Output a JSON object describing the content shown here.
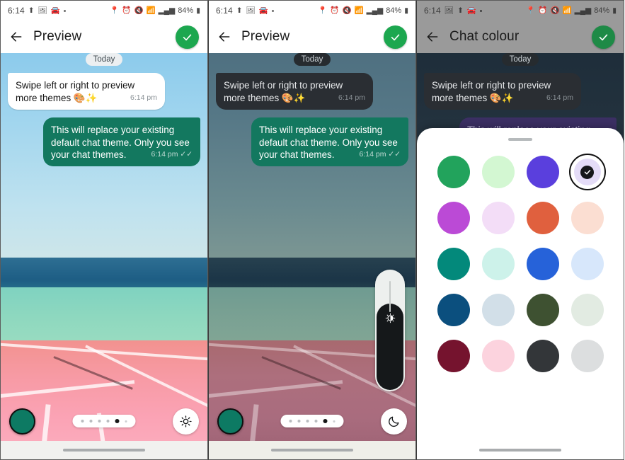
{
  "status_bar": {
    "time": "6:14",
    "battery": "84%",
    "left_icons": [
      "upload-icon",
      "gallery-icon",
      "car-icon",
      "dot-icon"
    ],
    "right_icons": [
      "location-icon",
      "alarm-icon",
      "mute-icon",
      "wifi-icon",
      "signal-icon"
    ]
  },
  "panels": [
    {
      "id": "preview-light",
      "title": "Preview",
      "back_icon": "back-arrow-icon",
      "confirm_icon": "check-icon",
      "theme": "light",
      "mode_button_icon": "sun-icon",
      "swatch_color": "#0d7a63",
      "chat": {
        "day_label": "Today",
        "incoming": {
          "text": "Swipe left or right to preview more themes ",
          "emoji": "🎨✨",
          "time": "6:14 pm"
        },
        "outgoing": {
          "text": "This will replace your existing default chat theme. Only you see your chat themes.",
          "time": "6:14 pm",
          "ticks": "✓✓"
        }
      },
      "pager": {
        "count": 6,
        "active_index": 4
      }
    },
    {
      "id": "preview-dim",
      "title": "Preview",
      "back_icon": "back-arrow-icon",
      "confirm_icon": "check-icon",
      "theme": "dim",
      "mode_button_icon": "moon-icon",
      "swatch_color": "#0d7a63",
      "brightness_slider": {
        "icon": "brightness-icon",
        "value": 72
      },
      "chat": {
        "day_label": "Today",
        "incoming": {
          "text": "Swipe left or right to preview more themes ",
          "emoji": "🎨✨",
          "time": "6:14 pm"
        },
        "outgoing": {
          "text": "This will replace your existing default chat theme. Only you see your chat themes.",
          "time": "6:14 pm",
          "ticks": "✓✓"
        }
      },
      "pager": {
        "count": 6,
        "active_index": 4
      }
    },
    {
      "id": "chat-colour",
      "title": "Chat colour",
      "back_icon": "back-arrow-icon",
      "confirm_icon": "check-icon",
      "theme": "dark",
      "chat": {
        "day_label": "Today",
        "incoming": {
          "text": "Swipe left or right to preview more themes ",
          "emoji": "🎨✨",
          "time": "6:14 pm"
        },
        "outgoing": {
          "text": "This will replace your existing",
          "time": "",
          "ticks": ""
        }
      },
      "sheet": {
        "handle": "drag-handle",
        "selected_index": 3,
        "check_icon": "check-icon",
        "swatches": [
          {
            "name": "green",
            "hex": "#22a35c"
          },
          {
            "name": "mint",
            "hex": "#d3f7d2"
          },
          {
            "name": "indigo",
            "hex": "#5a3fdd"
          },
          {
            "name": "lavender",
            "hex": "#e4dcf7"
          },
          {
            "name": "orchid",
            "hex": "#bb4ad6"
          },
          {
            "name": "pale-lilac",
            "hex": "#f3ddf7"
          },
          {
            "name": "coral",
            "hex": "#e0603e"
          },
          {
            "name": "peach",
            "hex": "#fbded2"
          },
          {
            "name": "teal",
            "hex": "#03897b"
          },
          {
            "name": "pale-aqua",
            "hex": "#cdf2ea"
          },
          {
            "name": "blue",
            "hex": "#2662d9"
          },
          {
            "name": "pale-blue",
            "hex": "#d7e7fb"
          },
          {
            "name": "navy",
            "hex": "#0b4f7e"
          },
          {
            "name": "light-steel",
            "hex": "#d2dfe8"
          },
          {
            "name": "forest",
            "hex": "#3e5131"
          },
          {
            "name": "pale-sage",
            "hex": "#e2ebe2"
          },
          {
            "name": "maroon",
            "hex": "#75132e"
          },
          {
            "name": "pink",
            "hex": "#fcd3de"
          },
          {
            "name": "charcoal",
            "hex": "#333639"
          },
          {
            "name": "light-grey",
            "hex": "#dcdedf"
          }
        ]
      }
    }
  ]
}
